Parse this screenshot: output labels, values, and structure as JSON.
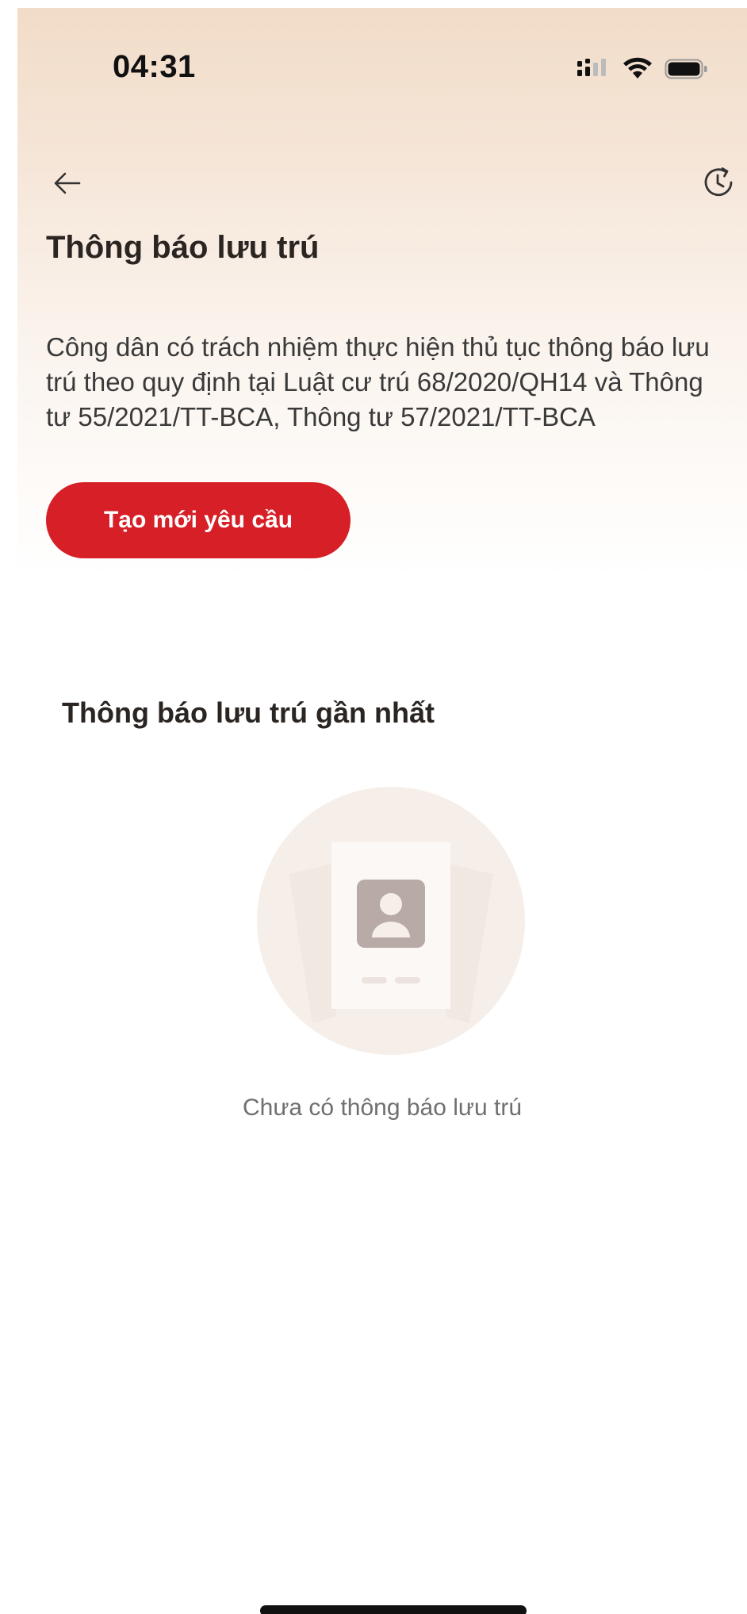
{
  "status_bar": {
    "time": "04:31",
    "icons": [
      "cellular-signal-icon",
      "wifi-icon",
      "battery-icon"
    ]
  },
  "header": {
    "back_icon": "arrow-left-icon",
    "history_icon": "clock-history-icon"
  },
  "page": {
    "title": "Thông báo lưu trú",
    "description": "Công dân có trách nhiệm thực hiện thủ tục thông báo lưu trú theo quy định tại Luật cư trú 68/2020/QH14 và Thông tư 55/2021/TT-BCA, Thông tư 57/2021/TT-BCA",
    "create_button_label": "Tạo mới yêu cầu"
  },
  "recent": {
    "title": "Thông báo lưu trú gần nhất",
    "empty_icon": "empty-document-person-icon",
    "empty_message": "Chưa có thông báo lưu trú"
  },
  "colors": {
    "accent": "#d61f26",
    "gradient_top": "#f1dcc8",
    "illustration_circle": "#f6efe9",
    "illustration_avatar": "#b8aaa6"
  }
}
